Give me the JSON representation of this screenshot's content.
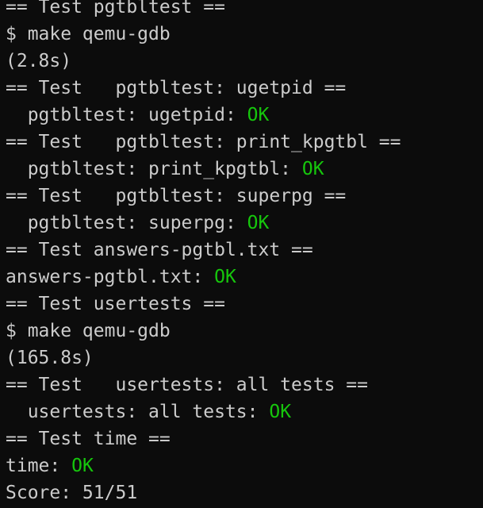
{
  "terminal": {
    "ok_color": "#16c60c",
    "text_color": "#cccccc",
    "background": "#0c0c0c",
    "lines": [
      {
        "text": "== Test pgtbltest =="
      },
      {
        "text": "$ make qemu-gdb"
      },
      {
        "text": "(2.8s)"
      },
      {
        "text": "== Test   pgtbltest: ugetpid =="
      },
      {
        "text": "  pgtbltest: ugetpid: ",
        "status": "OK"
      },
      {
        "text": "== Test   pgtbltest: print_kpgtbl =="
      },
      {
        "text": "  pgtbltest: print_kpgtbl: ",
        "status": "OK"
      },
      {
        "text": "== Test   pgtbltest: superpg =="
      },
      {
        "text": "  pgtbltest: superpg: ",
        "status": "OK"
      },
      {
        "text": "== Test answers-pgtbl.txt =="
      },
      {
        "text": "answers-pgtbl.txt: ",
        "status": "OK"
      },
      {
        "text": "== Test usertests =="
      },
      {
        "text": "$ make qemu-gdb"
      },
      {
        "text": "(165.8s)"
      },
      {
        "text": "== Test   usertests: all tests =="
      },
      {
        "text": "  usertests: all tests: ",
        "status": "OK"
      },
      {
        "text": "== Test time =="
      },
      {
        "text": "time: ",
        "status": "OK"
      },
      {
        "text": "Score: 51/51"
      }
    ]
  }
}
